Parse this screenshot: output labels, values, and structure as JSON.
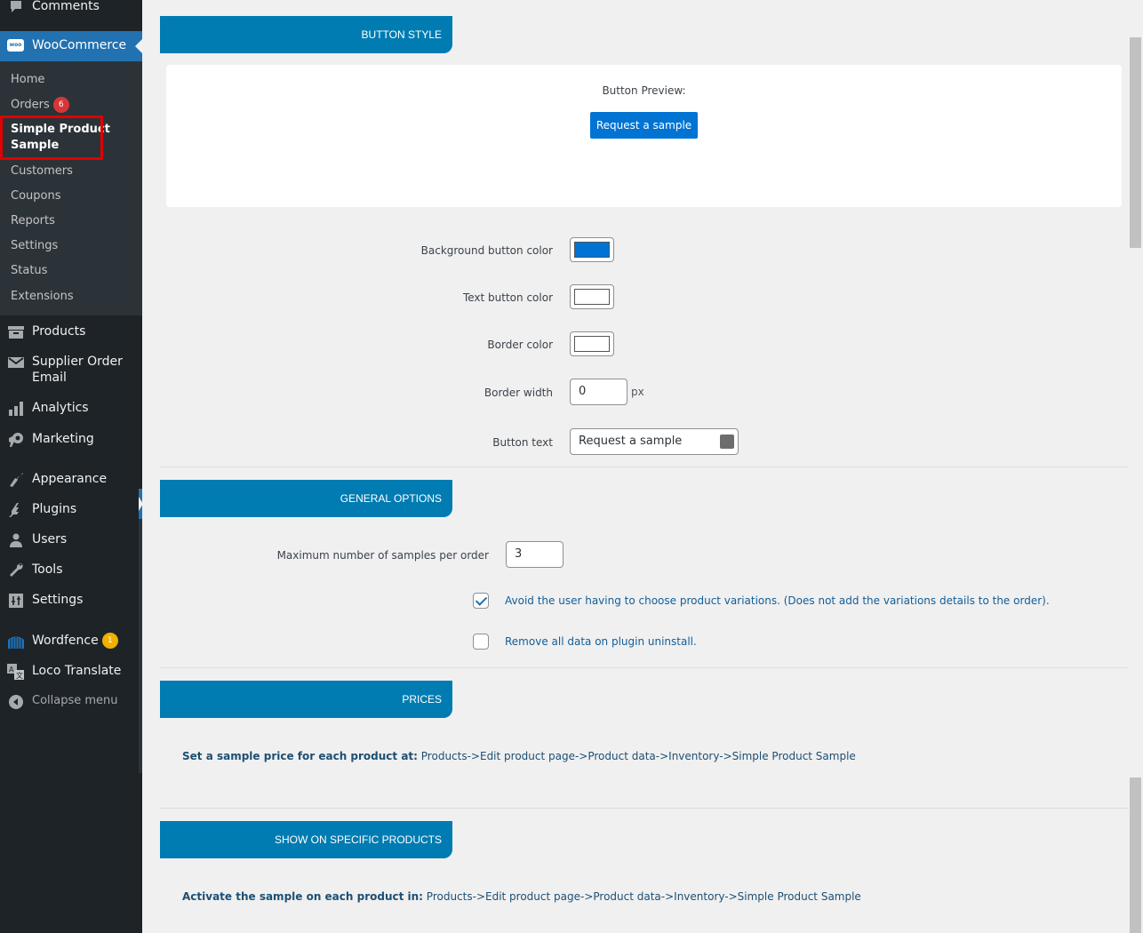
{
  "sidebar": {
    "top_items": [
      {
        "label": "Comments",
        "icon": "comment-icon"
      }
    ],
    "woocommerce": {
      "label": "WooCommerce",
      "logo_text": "woo"
    },
    "submenu": [
      {
        "label": "Home"
      },
      {
        "label": "Orders",
        "badge": "6"
      },
      {
        "label": "Simple Product",
        "label2": "Sample",
        "current": true
      },
      {
        "label": "Customers"
      },
      {
        "label": "Coupons"
      },
      {
        "label": "Reports"
      },
      {
        "label": "Settings"
      },
      {
        "label": "Status"
      },
      {
        "label": "Extensions"
      }
    ],
    "items": [
      {
        "label": "Products",
        "icon": "archive-icon"
      },
      {
        "label": "Supplier Order",
        "label2": "Email",
        "icon": "envelope-icon"
      },
      {
        "label": "Analytics",
        "icon": "bar-chart-icon"
      },
      {
        "label": "Marketing",
        "icon": "megaphone-icon"
      },
      {
        "label": "Appearance",
        "icon": "paintbrush-icon"
      },
      {
        "label": "Plugins",
        "icon": "plug-icon"
      },
      {
        "label": "Users",
        "icon": "user-icon"
      },
      {
        "label": "Tools",
        "icon": "wrench-icon"
      },
      {
        "label": "Settings",
        "icon": "sliders-icon"
      },
      {
        "label": "Wordfence",
        "icon": "wordfence-icon",
        "badge": "1"
      },
      {
        "label": "Loco Translate",
        "icon": "translate-icon"
      },
      {
        "label": "Collapse menu",
        "icon": "collapse-icon"
      }
    ]
  },
  "sections": {
    "button_style": {
      "title": "BUTTON STYLE",
      "preview_label": "Button Preview:",
      "preview_button": "Request a sample",
      "fields": {
        "background_color": {
          "label": "Background button color",
          "value": "#0073d3"
        },
        "text_color": {
          "label": "Text button color",
          "value": "#ffffff"
        },
        "border_color": {
          "label": "Border color",
          "value": "#ffffff"
        },
        "border_width": {
          "label": "Border width",
          "value": "0",
          "unit": "px"
        },
        "button_text": {
          "label": "Button text",
          "value": "Request a sample"
        }
      }
    },
    "general_options": {
      "title": "GENERAL OPTIONS",
      "max_samples": {
        "label": "Maximum number of samples per order",
        "value": "3"
      },
      "avoid_variations": {
        "label": "Avoid the user having to choose product variations. (Does not add the variations details to the order).",
        "checked": true
      },
      "remove_data": {
        "label": "Remove all data on plugin uninstall.",
        "checked": false
      }
    },
    "prices": {
      "title": "PRICES",
      "info_bold": "Set a sample price for each product at:",
      "info_path": " Products->Edit product page->Product data->Inventory->Simple Product Sample"
    },
    "show_on_products": {
      "title": "SHOW ON SPECIFIC PRODUCTS",
      "info_bold": "Activate the sample on each product in:",
      "info_path": " Products->Edit product page->Product data->Inventory->Simple Product Sample"
    }
  },
  "colors": {
    "accent": "#007cb2",
    "sidebar_bg": "#1d2327",
    "wp_blue": "#2271b1"
  }
}
